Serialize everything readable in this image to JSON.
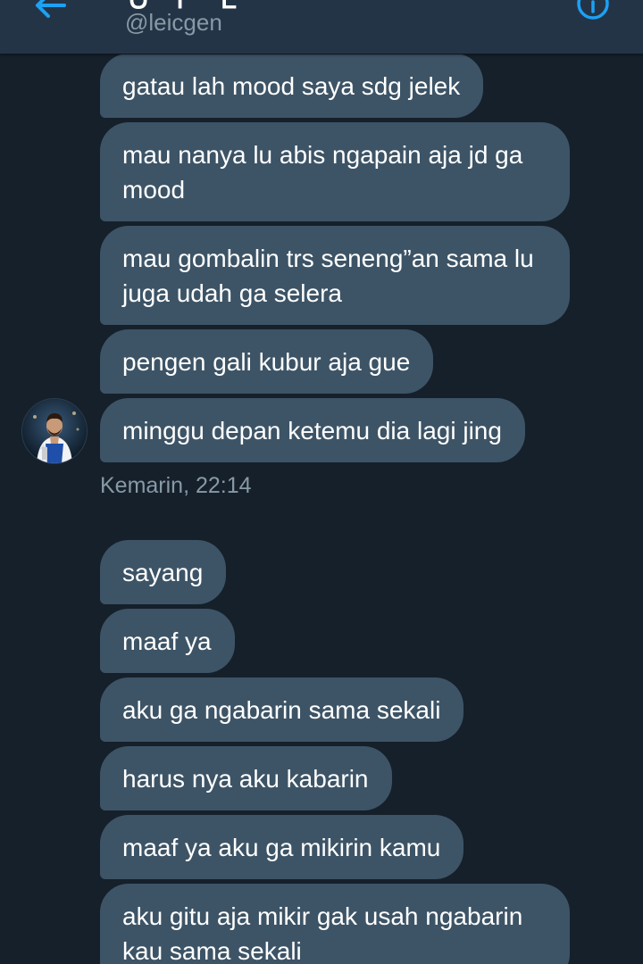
{
  "header": {
    "title": "Ｕ ｒ Ｌ",
    "handle": "@leicgen",
    "back_icon": "arrow-left-icon",
    "info_icon": "info-circle-icon",
    "accent_color": "#1da1f2"
  },
  "messages_group_1": [
    {
      "text": "gatau lah mood saya sdg jelek"
    },
    {
      "text": "mau nanya lu abis ngapain aja jd ga mood"
    },
    {
      "text": "mau gombalin trs seneng”an sama lu juga udah ga selera"
    },
    {
      "text": "pengen gali kubur aja gue"
    },
    {
      "text": "minggu depan ketemu dia lagi jing"
    }
  ],
  "timestamp": "Kemarin, 22:14",
  "messages_group_2": [
    {
      "text": "sayang"
    },
    {
      "text": "maaf ya"
    },
    {
      "text": "aku ga ngabarin sama sekali"
    },
    {
      "text": "harus nya aku kabarin"
    },
    {
      "text": "maaf ya aku ga mikirin kamu"
    },
    {
      "text": "aku gitu aja mikir gak usah ngabarin kau sama sekali"
    }
  ],
  "colors": {
    "background": "#15202b",
    "header_bg": "#243447",
    "bubble_bg": "#3d5466",
    "secondary_text": "#8899a6"
  }
}
